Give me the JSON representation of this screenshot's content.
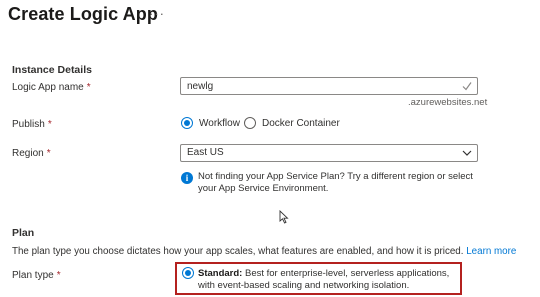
{
  "header": {
    "title": "Create Logic App",
    "more_label": "···"
  },
  "instance": {
    "section_title": "Instance Details",
    "name_label": "Logic App name",
    "name_value": "newlg",
    "name_suffix": ".azurewebsites.net",
    "publish_label": "Publish",
    "publish_options": [
      "Workflow",
      "Docker Container"
    ],
    "publish_selected": "Workflow",
    "region_label": "Region",
    "region_value": "East US",
    "region_info": "Not finding your App Service Plan? Try a different region or select your App Service Environment."
  },
  "plan": {
    "section_title": "Plan",
    "description": "The plan type you choose dictates how your app scales, what features are enabled, and how it is priced.",
    "learn_more": "Learn more",
    "type_label": "Plan type",
    "standard_title": "Standard:",
    "standard_desc": "Best for enterprise-level, serverless applications, with event-based scaling and networking isolation."
  },
  "required_marker": "*",
  "colors": {
    "accent": "#0078d4",
    "highlight_border": "#b4211f",
    "required": "#a4262c"
  }
}
